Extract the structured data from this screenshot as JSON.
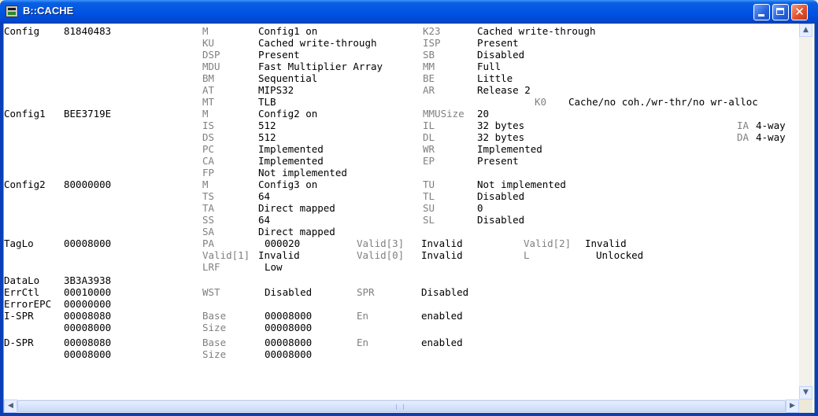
{
  "window": {
    "title": "B::CACHE"
  },
  "registers": [
    {
      "name": "Config",
      "value": "81840483",
      "fields": [
        [
          "M",
          "Config1 on",
          "K23",
          "Cached write-through"
        ],
        [
          "KU",
          "Cached write-through",
          "ISP",
          "Present"
        ],
        [
          "DSP",
          "Present",
          "SB",
          "Disabled"
        ],
        [
          "MDU",
          "Fast Multiplier Array",
          "MM",
          "Full"
        ],
        [
          "BM",
          "Sequential",
          "BE",
          "Little"
        ],
        [
          "AT",
          "MIPS32",
          "AR",
          "Release 2"
        ],
        [
          "MT",
          "TLB",
          "K0",
          "Cache/no coh./wr-thr/no wr-alloc"
        ]
      ]
    },
    {
      "name": "Config1",
      "value": "BEE3719E",
      "fields": [
        [
          "M",
          "Config2 on",
          "MMUSize",
          "20"
        ],
        [
          "IS",
          "512",
          "IL",
          "32 bytes",
          "IA",
          "4-way"
        ],
        [
          "DS",
          "512",
          "DL",
          "32 bytes",
          "DA",
          "4-way"
        ],
        [
          "PC",
          "Implemented",
          "WR",
          "Implemented"
        ],
        [
          "CA",
          "Implemented",
          "EP",
          "Present"
        ],
        [
          "FP",
          "Not implemented"
        ]
      ]
    },
    {
      "name": "Config2",
      "value": "80000000",
      "fields": [
        [
          "M",
          "Config3 on",
          "TU",
          "Not implemented"
        ],
        [
          "TS",
          "64",
          "TL",
          "Disabled"
        ],
        [
          "TA",
          "Direct mapped",
          "SU",
          "0"
        ],
        [
          "SS",
          "64",
          "SL",
          "Disabled"
        ],
        [
          "SA",
          "Direct mapped"
        ]
      ]
    },
    {
      "name": "TagLo",
      "value": "00008000",
      "fields": [
        [
          "PA",
          "000020",
          "Valid[3]",
          "Invalid",
          "Valid[2]",
          "Invalid"
        ],
        [
          "Valid[1]",
          "Invalid",
          "Valid[0]",
          "Invalid",
          "L",
          "Unlocked"
        ],
        [
          "LRF",
          "Low"
        ]
      ]
    },
    {
      "name": "DataLo",
      "value": "3B3A3938"
    },
    {
      "name": "ErrCtl",
      "value": "00010000",
      "fields": [
        [
          "WST",
          "Disabled",
          "SPR",
          "Disabled"
        ]
      ]
    },
    {
      "name": "ErrorEPC",
      "value": "00000000"
    },
    {
      "name": "I-SPR",
      "value": "00008080",
      "value2": "00008000",
      "fields": [
        [
          "Base",
          "00008000",
          "En",
          "enabled"
        ],
        [
          "Size",
          "00008000"
        ]
      ]
    },
    {
      "name": "D-SPR",
      "value": "00008080",
      "value2": "00008000",
      "fields": [
        [
          "Base",
          "00008000",
          "En",
          "enabled"
        ],
        [
          "Size",
          "00008000"
        ]
      ]
    }
  ],
  "icons": {
    "minimize": "minimize-icon",
    "maximize": "maximize-icon",
    "close": "close-icon",
    "close_glyph": "✕",
    "scroll_up": "▲",
    "scroll_down": "▼",
    "scroll_left": "◀",
    "scroll_right": "▶"
  },
  "colors": {
    "titlebar": "#0055e5",
    "background": "#ffffff",
    "field_label": "#808080",
    "value_text": "#000000"
  }
}
